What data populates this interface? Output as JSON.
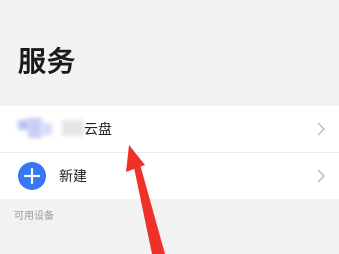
{
  "page": {
    "title": "服务"
  },
  "services": [
    {
      "label": "云盘"
    },
    {
      "label": "新建"
    }
  ],
  "section": {
    "label": "可用设备"
  },
  "colors": {
    "accent": "#3478f6",
    "annotation_arrow": "#f0312a"
  },
  "icons": {
    "chevron": "chevron-right-icon",
    "add": "plus-icon"
  }
}
